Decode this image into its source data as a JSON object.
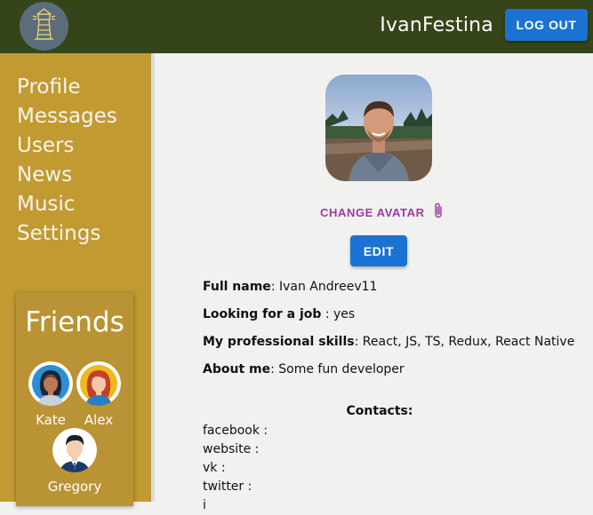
{
  "header": {
    "logo_icon": "lighthouse-icon",
    "username": "IvanFestina",
    "logout_label": "LOG OUT",
    "background": "#364519",
    "button_color": "#1a73d2"
  },
  "sidebar": {
    "background": "#c19a32",
    "items": [
      {
        "label": "Profile"
      },
      {
        "label": "Messages"
      },
      {
        "label": "Users"
      },
      {
        "label": "News"
      },
      {
        "label": "Music"
      },
      {
        "label": "Settings"
      }
    ],
    "friends": {
      "title": "Friends",
      "list": [
        {
          "name": "Kate",
          "icon": "female-avatar-icon"
        },
        {
          "name": "Alex",
          "icon": "female-avatar-icon"
        },
        {
          "name": "Gregory",
          "icon": "male-avatar-icon"
        }
      ]
    }
  },
  "profile": {
    "change_avatar_label": "CHANGE AVATAR",
    "change_avatar_icon": "paperclip-icon",
    "edit_label": "EDIT",
    "full_name_label": "Full name",
    "full_name_value": "Ivan Andreev11",
    "looking_for_job_label": "Looking for a job",
    "looking_for_job_value": "yes",
    "skills_label": "My professional skills",
    "skills_value": "React, JS, TS, Redux, React Native",
    "about_label": "About me",
    "about_value": "Some fun developer",
    "accent_color": "#9d3aa0"
  },
  "contacts": {
    "title": "Contacts:",
    "items": [
      {
        "label": "facebook :"
      },
      {
        "label": "website :"
      },
      {
        "label": "vk :"
      },
      {
        "label": "twitter :"
      },
      {
        "label": "i"
      }
    ]
  }
}
